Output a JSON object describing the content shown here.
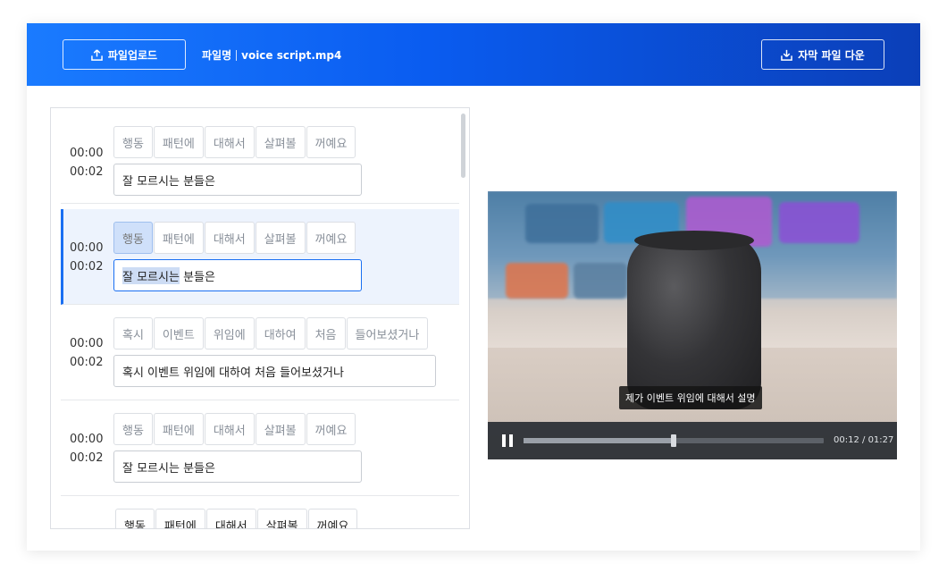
{
  "header": {
    "upload_label": "파일업로드",
    "filename_label": "파일명",
    "filename": "voice script.mp4",
    "download_label": "자막 파일 다운",
    "upload_icon": "upload-icon",
    "download_icon": "download-icon"
  },
  "subtitles": [
    {
      "start": "00:00",
      "end": "00:02",
      "tokens": [
        "행동",
        "패턴에",
        "대해서",
        "살펴볼",
        "꺼예요"
      ],
      "text": "잘 모르시는 분들은",
      "active": false
    },
    {
      "start": "00:00",
      "end": "00:02",
      "tokens": [
        "행동",
        "패턴에",
        "대해서",
        "살펴볼",
        "꺼예요"
      ],
      "text_highlight": "잘 모르시는",
      "text_rest": " 분들은",
      "active": true,
      "selected_token": "행동"
    },
    {
      "start": "00:00",
      "end": "00:02",
      "tokens": [
        "혹시",
        "이벤트",
        "위임에",
        "대하여",
        "처음",
        "들어보셨거나"
      ],
      "text": "혹시 이벤트 위임에 대하여 처음 들어보셨거나",
      "active": false
    },
    {
      "start": "00:00",
      "end": "00:02",
      "tokens": [
        "행동",
        "패턴에",
        "대해서",
        "살펴볼",
        "꺼예요"
      ],
      "text": "잘 모르시는 분들은",
      "active": false
    },
    {
      "tokens": [
        "행동",
        "패턴에",
        "대해서",
        "살펴볼",
        "꺼예요"
      ]
    }
  ],
  "player": {
    "caption": "제가 이벤트 위임에 대해서 설명",
    "current_time": "00:12",
    "duration": "01:27",
    "time_separator": " / ",
    "progress": 0.5,
    "pause_icon": "pause-icon"
  },
  "colors": {
    "accent": "#1a6ff2",
    "header_start": "#1a7bff",
    "header_end": "#0b3fb8"
  }
}
